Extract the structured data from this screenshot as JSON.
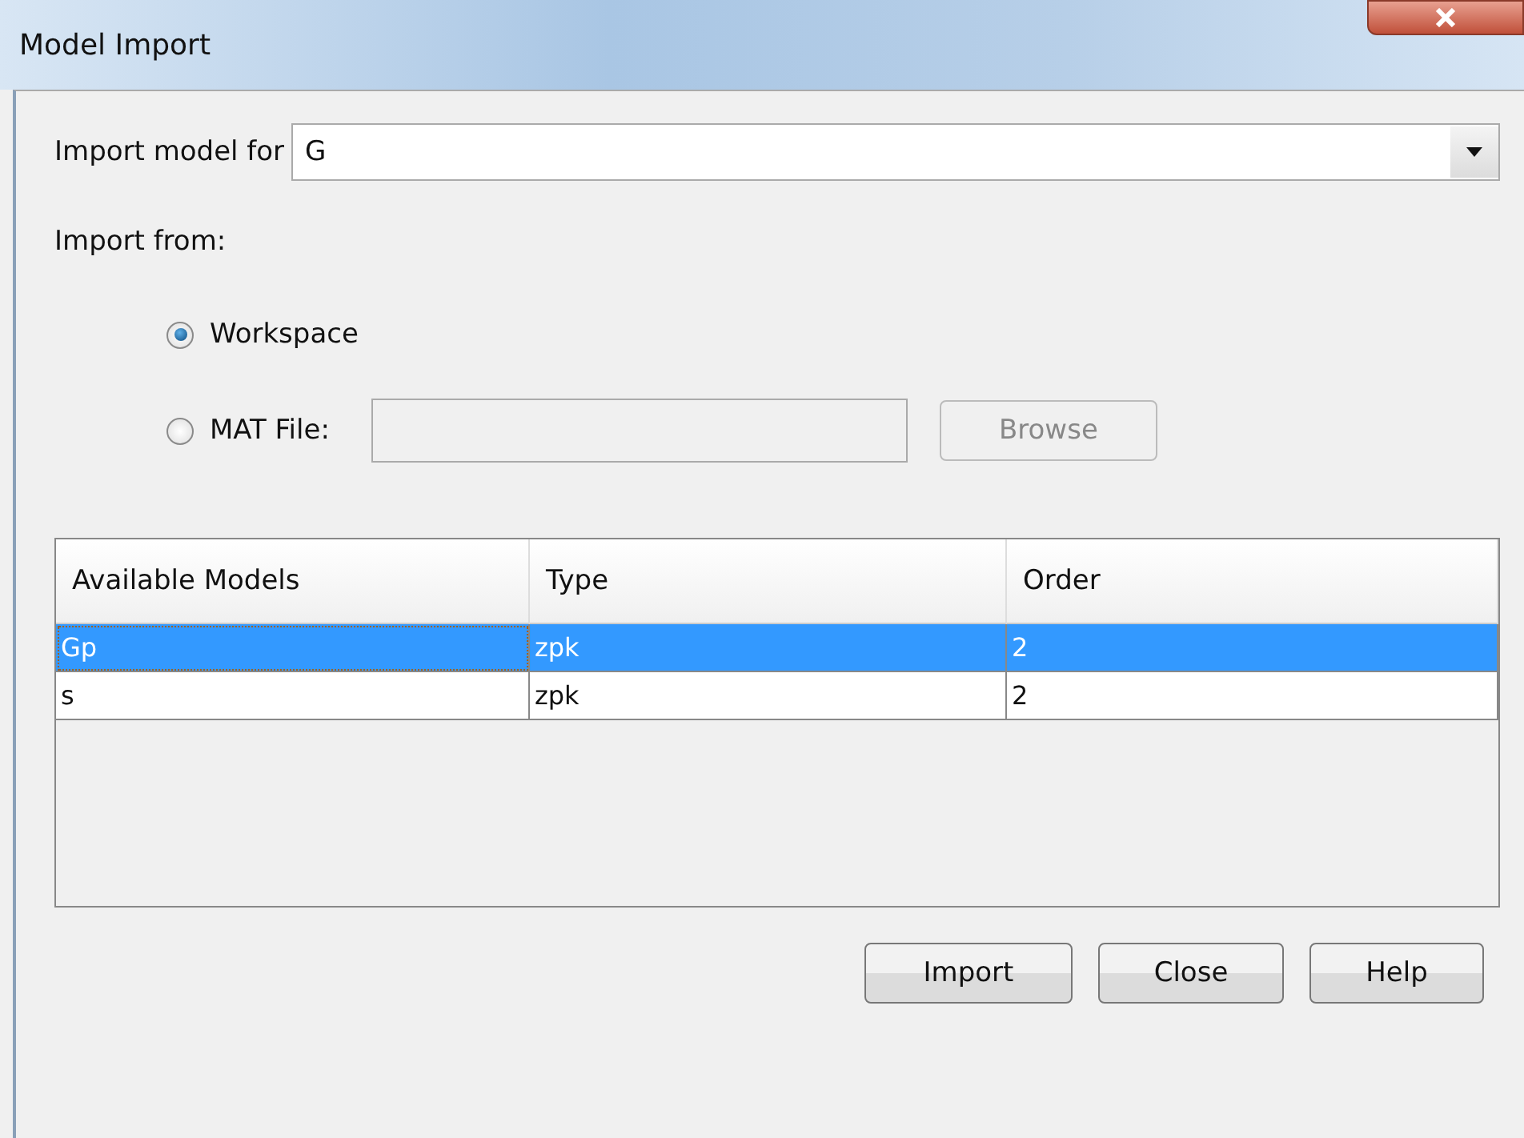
{
  "window": {
    "title": "Model Import"
  },
  "import_for": {
    "label": "Import model for",
    "value": "G"
  },
  "import_from": {
    "label": "Import from:",
    "options": [
      {
        "label": "Workspace",
        "selected": true
      },
      {
        "label": "MAT File:",
        "selected": false
      }
    ]
  },
  "mat_file": {
    "browse": "Browse",
    "disabled": true
  },
  "table": {
    "columns": [
      "Available Models",
      "Type",
      "Order"
    ],
    "rows": [
      {
        "cells": [
          "Gp",
          "zpk",
          "2"
        ],
        "selected": true
      },
      {
        "cells": [
          "s",
          "zpk",
          "2"
        ],
        "selected": false
      }
    ]
  },
  "buttons": [
    "Import",
    "Close",
    "Help"
  ]
}
